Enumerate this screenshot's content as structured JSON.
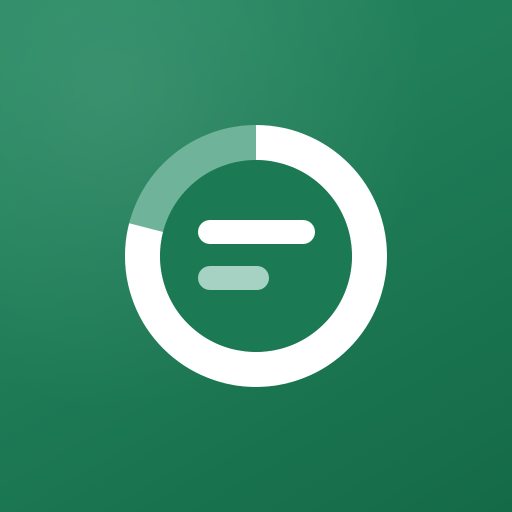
{
  "app_icon": {
    "name": "progress-ring-logo",
    "icon": "circular-progress-filter-icon",
    "progress_fraction": 0.79,
    "colors": {
      "background_light": "#278a63",
      "background_dark": "#146a47",
      "ring_progress": "#ffffff",
      "ring_track": "#6fb49a",
      "inner_disc": "#1b7a53",
      "bar_primary": "#ffffff",
      "bar_secondary": "#a5d2c2"
    }
  }
}
